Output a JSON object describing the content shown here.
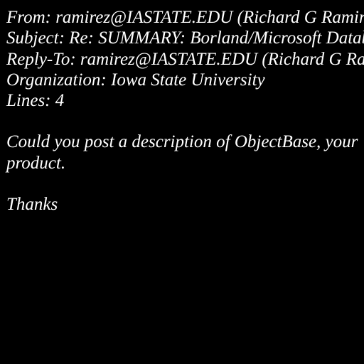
{
  "email": {
    "headers": {
      "from": "From: ramirez@IASTATE.EDU (Richard G Ramirez)",
      "subject": "Subject: Re: SUMMARY: Borland/Microsoft Database Info",
      "reply_to": "Reply-To: ramirez@IASTATE.EDU (Richard G Ramirez)",
      "organization": "Organization: Iowa State University",
      "lines": "Lines: 4"
    },
    "body": {
      "line1": "Could you post a description of ObjectBase, your",
      "line2": "product.",
      "signoff": "Thanks"
    }
  },
  "colors": {
    "background": "#000000",
    "text": "#ffffff"
  }
}
